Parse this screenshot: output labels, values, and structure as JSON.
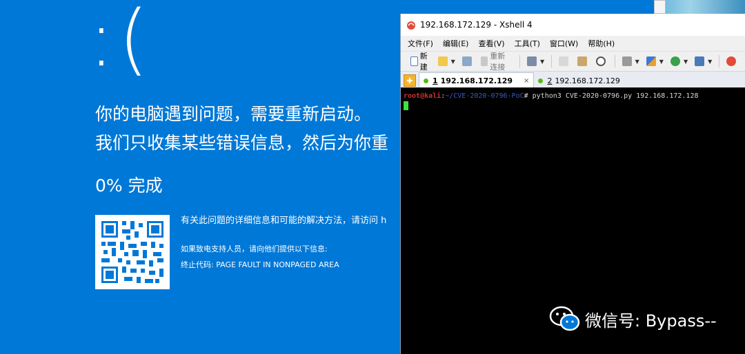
{
  "bsod": {
    "face": ":(",
    "message_line1": "你的电脑遇到问题，需要重新启动。",
    "message_line2": "我们只收集某些错误信息，然后为你重",
    "progress": "0% 完成",
    "info_line": "有关此问题的详细信息和可能的解决方法，请访问 h",
    "support_line": "如果致电支持人员，请向他们提供以下信息:",
    "stop_code_label": "终止代码:",
    "stop_code": "PAGE FAULT IN NONPAGED AREA"
  },
  "xshell": {
    "title": "192.168.172.129 - Xshell 4",
    "menu": [
      "文件(F)",
      "编辑(E)",
      "查看(V)",
      "工具(T)",
      "窗口(W)",
      "帮助(H)"
    ],
    "toolbar": {
      "new_label": "新建",
      "reconnect_label": "重新连接"
    },
    "tabs": [
      {
        "index": "1",
        "label": "192.168.172.129",
        "active": true,
        "close": "×"
      },
      {
        "index": "2",
        "label": "192.168.172.129",
        "active": false
      }
    ],
    "terminal": {
      "user": "root@kali",
      "sep": ":",
      "path": "~/CVE-2020-0796-PoC",
      "prompt": "#",
      "command": " python3 CVE-2020-0796.py 192.168.172.128"
    }
  },
  "watermark": {
    "text": "微信号: Bypass--"
  },
  "colors": {
    "bsod_blue": "#0078d7",
    "terminal_bg": "#000000",
    "cursor": "#3ee23e",
    "prompt_user": "#d43030"
  }
}
